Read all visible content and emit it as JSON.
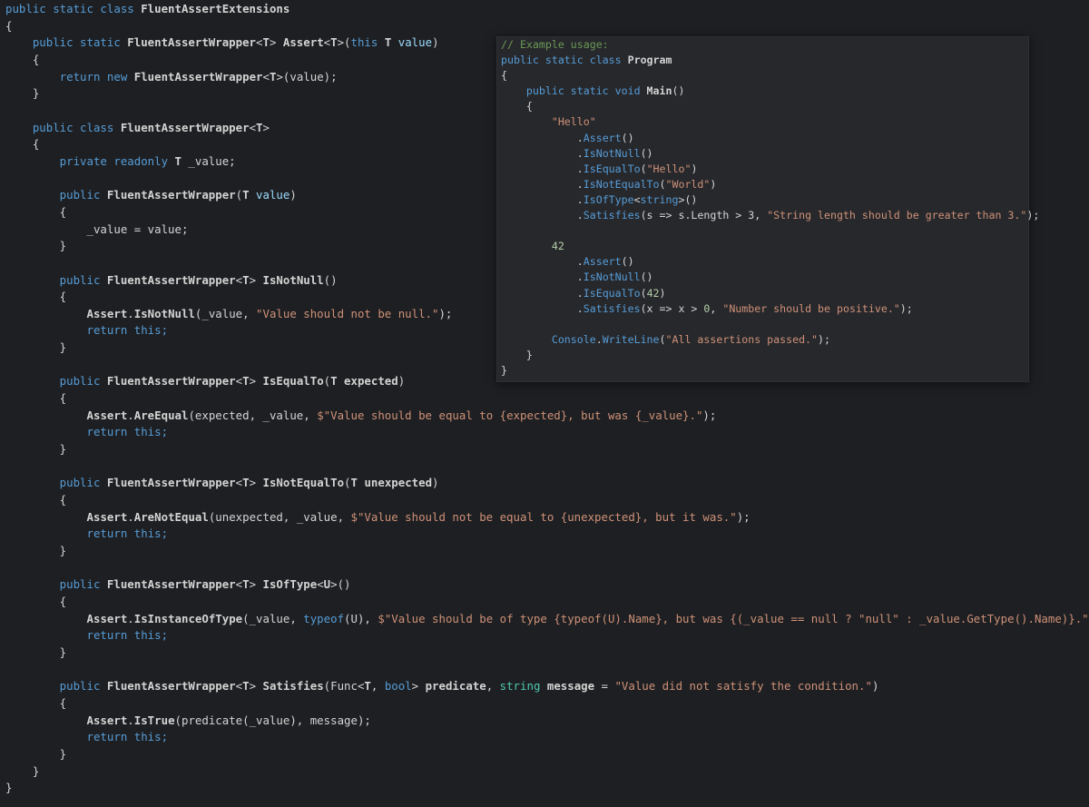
{
  "theme": {
    "background": "#1e1f22",
    "popup_background": "#27282c",
    "keyword_color": "#569cd6",
    "string_color": "#ce9178",
    "number_color": "#b5cea8",
    "comment_color": "#6a9955",
    "type_color": "#4ec9b0",
    "text_color": "#d4d4d4"
  },
  "main_code": {
    "lines": [
      [
        {
          "t": "public static class ",
          "c": "kw"
        },
        {
          "t": "FluentAssertExtensions",
          "c": "type"
        }
      ],
      [
        {
          "t": "{",
          "c": "punct"
        }
      ],
      [
        {
          "t": "    public static ",
          "c": "kw"
        },
        {
          "t": "FluentAssertWrapper",
          "c": "type"
        },
        {
          "t": "<",
          "c": "punct"
        },
        {
          "t": "T",
          "c": "type"
        },
        {
          "t": "> ",
          "c": "punct"
        },
        {
          "t": "Assert",
          "c": "type"
        },
        {
          "t": "<",
          "c": "punct"
        },
        {
          "t": "T",
          "c": "type"
        },
        {
          "t": ">(",
          "c": "punct"
        },
        {
          "t": "this ",
          "c": "kw"
        },
        {
          "t": "T ",
          "c": "type"
        },
        {
          "t": "value",
          "c": "param"
        },
        {
          "t": ")",
          "c": "punct"
        }
      ],
      [
        {
          "t": "    {",
          "c": "punct"
        }
      ],
      [
        {
          "t": "        return new ",
          "c": "kw"
        },
        {
          "t": "FluentAssertWrapper",
          "c": "type"
        },
        {
          "t": "<",
          "c": "punct"
        },
        {
          "t": "T",
          "c": "type"
        },
        {
          "t": ">(value);",
          "c": "punct"
        }
      ],
      [
        {
          "t": "    }",
          "c": "punct"
        }
      ],
      [
        {
          "t": "",
          "c": "punct"
        }
      ],
      [
        {
          "t": "    public class ",
          "c": "kw"
        },
        {
          "t": "FluentAssertWrapper",
          "c": "type"
        },
        {
          "t": "<",
          "c": "punct"
        },
        {
          "t": "T",
          "c": "type"
        },
        {
          "t": ">",
          "c": "punct"
        }
      ],
      [
        {
          "t": "    {",
          "c": "punct"
        }
      ],
      [
        {
          "t": "        private readonly ",
          "c": "kw"
        },
        {
          "t": "T ",
          "c": "type"
        },
        {
          "t": "_value;",
          "c": "punct"
        }
      ],
      [
        {
          "t": "",
          "c": "punct"
        }
      ],
      [
        {
          "t": "        public ",
          "c": "kw"
        },
        {
          "t": "FluentAssertWrapper",
          "c": "type"
        },
        {
          "t": "(",
          "c": "punct"
        },
        {
          "t": "T ",
          "c": "type"
        },
        {
          "t": "value",
          "c": "param"
        },
        {
          "t": ")",
          "c": "punct"
        }
      ],
      [
        {
          "t": "        {",
          "c": "punct"
        }
      ],
      [
        {
          "t": "            _value = value;",
          "c": "punct"
        }
      ],
      [
        {
          "t": "        }",
          "c": "punct"
        }
      ],
      [
        {
          "t": "",
          "c": "punct"
        }
      ],
      [
        {
          "t": "        public ",
          "c": "kw"
        },
        {
          "t": "FluentAssertWrapper",
          "c": "type"
        },
        {
          "t": "<",
          "c": "punct"
        },
        {
          "t": "T",
          "c": "type"
        },
        {
          "t": "> ",
          "c": "punct"
        },
        {
          "t": "IsNotNull",
          "c": "type"
        },
        {
          "t": "()",
          "c": "punct"
        }
      ],
      [
        {
          "t": "        {",
          "c": "punct"
        }
      ],
      [
        {
          "t": "            ",
          "c": "punct"
        },
        {
          "t": "Assert",
          "c": "type"
        },
        {
          "t": ".",
          "c": "punct"
        },
        {
          "t": "IsNotNull",
          "c": "type"
        },
        {
          "t": "(_value, ",
          "c": "punct"
        },
        {
          "t": "\"Value should not be null.\"",
          "c": "str"
        },
        {
          "t": ");",
          "c": "punct"
        }
      ],
      [
        {
          "t": "            return this;",
          "c": "kw"
        }
      ],
      [
        {
          "t": "        }",
          "c": "punct"
        }
      ],
      [
        {
          "t": "",
          "c": "punct"
        }
      ],
      [
        {
          "t": "        public ",
          "c": "kw"
        },
        {
          "t": "FluentAssertWrapper",
          "c": "type"
        },
        {
          "t": "<",
          "c": "punct"
        },
        {
          "t": "T",
          "c": "type"
        },
        {
          "t": "> ",
          "c": "punct"
        },
        {
          "t": "IsEqualTo",
          "c": "type"
        },
        {
          "t": "(",
          "c": "punct"
        },
        {
          "t": "T ",
          "c": "type"
        },
        {
          "t": "expected",
          "c": "type"
        },
        {
          "t": ")",
          "c": "punct"
        }
      ],
      [
        {
          "t": "        {",
          "c": "punct"
        }
      ],
      [
        {
          "t": "            ",
          "c": "punct"
        },
        {
          "t": "Assert",
          "c": "type"
        },
        {
          "t": ".",
          "c": "punct"
        },
        {
          "t": "AreEqual",
          "c": "type"
        },
        {
          "t": "(expected, _value, ",
          "c": "punct"
        },
        {
          "t": "$\"Value should be equal to {expected}, but was {_value}.\"",
          "c": "str"
        },
        {
          "t": ");",
          "c": "punct"
        }
      ],
      [
        {
          "t": "            return this;",
          "c": "kw"
        }
      ],
      [
        {
          "t": "        }",
          "c": "punct"
        }
      ],
      [
        {
          "t": "",
          "c": "punct"
        }
      ],
      [
        {
          "t": "        public ",
          "c": "kw"
        },
        {
          "t": "FluentAssertWrapper",
          "c": "type"
        },
        {
          "t": "<",
          "c": "punct"
        },
        {
          "t": "T",
          "c": "type"
        },
        {
          "t": "> ",
          "c": "punct"
        },
        {
          "t": "IsNotEqualTo",
          "c": "type"
        },
        {
          "t": "(",
          "c": "punct"
        },
        {
          "t": "T ",
          "c": "type"
        },
        {
          "t": "unexpected",
          "c": "type"
        },
        {
          "t": ")",
          "c": "punct"
        }
      ],
      [
        {
          "t": "        {",
          "c": "punct"
        }
      ],
      [
        {
          "t": "            ",
          "c": "punct"
        },
        {
          "t": "Assert",
          "c": "type"
        },
        {
          "t": ".",
          "c": "punct"
        },
        {
          "t": "AreNotEqual",
          "c": "type"
        },
        {
          "t": "(unexpected, _value, ",
          "c": "punct"
        },
        {
          "t": "$\"Value should not be equal to {unexpected}, but it was.\"",
          "c": "str"
        },
        {
          "t": ");",
          "c": "punct"
        }
      ],
      [
        {
          "t": "            return this;",
          "c": "kw"
        }
      ],
      [
        {
          "t": "        }",
          "c": "punct"
        }
      ],
      [
        {
          "t": "",
          "c": "punct"
        }
      ],
      [
        {
          "t": "        public ",
          "c": "kw"
        },
        {
          "t": "FluentAssertWrapper",
          "c": "type"
        },
        {
          "t": "<",
          "c": "punct"
        },
        {
          "t": "T",
          "c": "type"
        },
        {
          "t": "> ",
          "c": "punct"
        },
        {
          "t": "IsOfType",
          "c": "type"
        },
        {
          "t": "<",
          "c": "punct"
        },
        {
          "t": "U",
          "c": "type"
        },
        {
          "t": ">()",
          "c": "punct"
        }
      ],
      [
        {
          "t": "        {",
          "c": "punct"
        }
      ],
      [
        {
          "t": "            ",
          "c": "punct"
        },
        {
          "t": "Assert",
          "c": "type"
        },
        {
          "t": ".",
          "c": "punct"
        },
        {
          "t": "IsInstanceOfType",
          "c": "type"
        },
        {
          "t": "(_value, ",
          "c": "punct"
        },
        {
          "t": "typeof",
          "c": "kw"
        },
        {
          "t": "(U), ",
          "c": "punct"
        },
        {
          "t": "$\"Value should be of type {typeof(U).Name}, but was {(_value == null ? \"null\" : _value.GetType().Name)}.\"",
          "c": "str"
        },
        {
          "t": ");",
          "c": "punct"
        }
      ],
      [
        {
          "t": "            return this;",
          "c": "kw"
        }
      ],
      [
        {
          "t": "        }",
          "c": "punct"
        }
      ],
      [
        {
          "t": "",
          "c": "punct"
        }
      ],
      [
        {
          "t": "        public ",
          "c": "kw"
        },
        {
          "t": "FluentAssertWrapper",
          "c": "type"
        },
        {
          "t": "<",
          "c": "punct"
        },
        {
          "t": "T",
          "c": "type"
        },
        {
          "t": "> ",
          "c": "punct"
        },
        {
          "t": "Satisfies",
          "c": "type"
        },
        {
          "t": "(Func<",
          "c": "punct"
        },
        {
          "t": "T",
          "c": "type"
        },
        {
          "t": ", ",
          "c": "punct"
        },
        {
          "t": "bool",
          "c": "kw"
        },
        {
          "t": "> ",
          "c": "punct"
        },
        {
          "t": "predicate",
          "c": "type"
        },
        {
          "t": ", ",
          "c": "punct"
        },
        {
          "t": "string ",
          "c": "ref"
        },
        {
          "t": "message",
          "c": "type"
        },
        {
          "t": " = ",
          "c": "punct"
        },
        {
          "t": "\"Value did not satisfy the condition.\"",
          "c": "str"
        },
        {
          "t": ")",
          "c": "punct"
        }
      ],
      [
        {
          "t": "        {",
          "c": "punct"
        }
      ],
      [
        {
          "t": "            ",
          "c": "punct"
        },
        {
          "t": "Assert",
          "c": "type"
        },
        {
          "t": ".",
          "c": "punct"
        },
        {
          "t": "IsTrue",
          "c": "type"
        },
        {
          "t": "(predicate(_value), message);",
          "c": "punct"
        }
      ],
      [
        {
          "t": "            return this;",
          "c": "kw"
        }
      ],
      [
        {
          "t": "        }",
          "c": "punct"
        }
      ],
      [
        {
          "t": "    }",
          "c": "punct"
        }
      ],
      [
        {
          "t": "}",
          "c": "punct"
        }
      ]
    ]
  },
  "popup_code": {
    "lines": [
      [
        {
          "t": "// Example usage:",
          "c": "cmt"
        }
      ],
      [
        {
          "t": "public static class ",
          "c": "kw"
        },
        {
          "t": "Program",
          "c": "type"
        }
      ],
      [
        {
          "t": "{",
          "c": "punct"
        }
      ],
      [
        {
          "t": "    public static void ",
          "c": "kw"
        },
        {
          "t": "Main",
          "c": "type"
        },
        {
          "t": "()",
          "c": "punct"
        }
      ],
      [
        {
          "t": "    {",
          "c": "punct"
        }
      ],
      [
        {
          "t": "        ",
          "c": "punct"
        },
        {
          "t": "\"Hello\"",
          "c": "str"
        }
      ],
      [
        {
          "t": "            .",
          "c": "punct"
        },
        {
          "t": "Assert",
          "c": "kw"
        },
        {
          "t": "()",
          "c": "punct"
        }
      ],
      [
        {
          "t": "            .",
          "c": "punct"
        },
        {
          "t": "IsNotNull",
          "c": "kw"
        },
        {
          "t": "()",
          "c": "punct"
        }
      ],
      [
        {
          "t": "            .",
          "c": "punct"
        },
        {
          "t": "IsEqualTo",
          "c": "kw"
        },
        {
          "t": "(",
          "c": "punct"
        },
        {
          "t": "\"Hello\"",
          "c": "str"
        },
        {
          "t": ")",
          "c": "punct"
        }
      ],
      [
        {
          "t": "            .",
          "c": "punct"
        },
        {
          "t": "IsNotEqualTo",
          "c": "kw"
        },
        {
          "t": "(",
          "c": "punct"
        },
        {
          "t": "\"World\"",
          "c": "str"
        },
        {
          "t": ")",
          "c": "punct"
        }
      ],
      [
        {
          "t": "            .",
          "c": "punct"
        },
        {
          "t": "IsOfType",
          "c": "kw"
        },
        {
          "t": "<",
          "c": "punct"
        },
        {
          "t": "string",
          "c": "kw"
        },
        {
          "t": ">()",
          "c": "punct"
        }
      ],
      [
        {
          "t": "            .",
          "c": "punct"
        },
        {
          "t": "Satisfies",
          "c": "kw"
        },
        {
          "t": "(s => s.Length > 3, ",
          "c": "punct"
        },
        {
          "t": "\"String length should be greater than 3.\"",
          "c": "str"
        },
        {
          "t": ");",
          "c": "punct"
        }
      ],
      [
        {
          "t": "",
          "c": "punct"
        }
      ],
      [
        {
          "t": "        ",
          "c": "punct"
        },
        {
          "t": "42",
          "c": "num"
        }
      ],
      [
        {
          "t": "            .",
          "c": "punct"
        },
        {
          "t": "Assert",
          "c": "kw"
        },
        {
          "t": "()",
          "c": "punct"
        }
      ],
      [
        {
          "t": "            .",
          "c": "punct"
        },
        {
          "t": "IsNotNull",
          "c": "kw"
        },
        {
          "t": "()",
          "c": "punct"
        }
      ],
      [
        {
          "t": "            .",
          "c": "punct"
        },
        {
          "t": "IsEqualTo",
          "c": "kw"
        },
        {
          "t": "(",
          "c": "punct"
        },
        {
          "t": "42",
          "c": "num"
        },
        {
          "t": ")",
          "c": "punct"
        }
      ],
      [
        {
          "t": "            .",
          "c": "punct"
        },
        {
          "t": "Satisfies",
          "c": "kw"
        },
        {
          "t": "(x => x > ",
          "c": "punct"
        },
        {
          "t": "0",
          "c": "num"
        },
        {
          "t": ", ",
          "c": "punct"
        },
        {
          "t": "\"Number should be positive.\"",
          "c": "str"
        },
        {
          "t": ");",
          "c": "punct"
        }
      ],
      [
        {
          "t": "",
          "c": "punct"
        }
      ],
      [
        {
          "t": "        Console",
          "c": "kw"
        },
        {
          "t": ".",
          "c": "punct"
        },
        {
          "t": "WriteLine",
          "c": "kw"
        },
        {
          "t": "(",
          "c": "punct"
        },
        {
          "t": "\"All assertions passed.\"",
          "c": "str"
        },
        {
          "t": ");",
          "c": "punct"
        }
      ],
      [
        {
          "t": "    }",
          "c": "punct"
        }
      ],
      [
        {
          "t": "}",
          "c": "punct"
        }
      ]
    ]
  }
}
